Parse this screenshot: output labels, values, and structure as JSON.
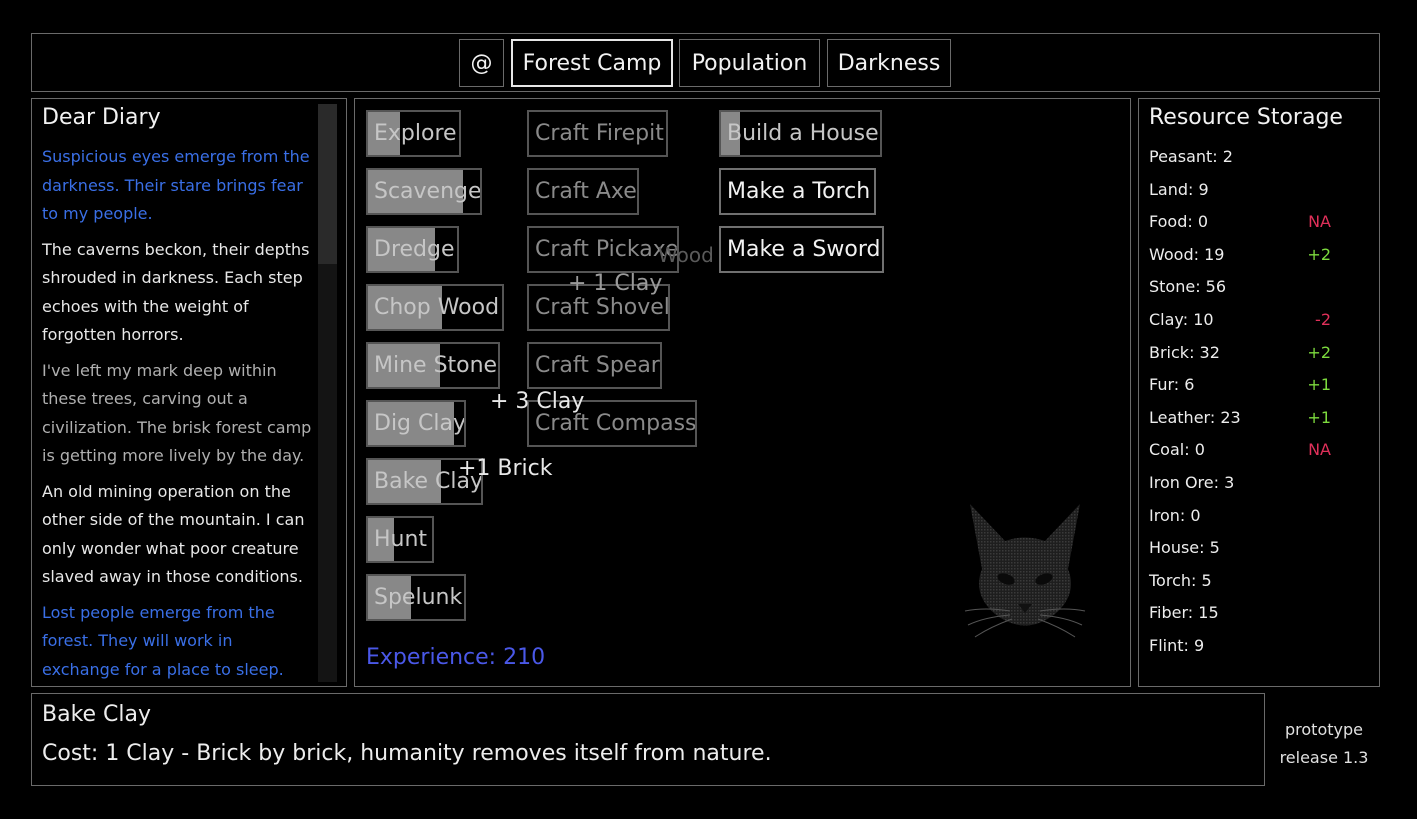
{
  "nav": {
    "home_label": "@",
    "tabs": [
      "Forest Camp",
      "Population",
      "Darkness"
    ]
  },
  "diary": {
    "title": "Dear Diary",
    "entries": [
      "Suspicious eyes emerge from the darkness. Their stare brings fear to my people.",
      "The caverns beckon, their depths shrouded in darkness. Each step echoes with the weight of forgotten horrors.",
      "I've left my mark deep within these trees, carving out a civilization. The brisk forest camp is getting more lively by the day.",
      "An old mining operation on the other side of the mountain. I can only wonder what poor creature slaved away in those conditions.",
      "Lost people emerge from the forest. They will work in exchange for a place to sleep."
    ]
  },
  "actions": {
    "gather": [
      {
        "label": "Explore",
        "progress": 0.35
      },
      {
        "label": "Scavenge",
        "progress": 0.85
      },
      {
        "label": "Dredge",
        "progress": 0.75
      },
      {
        "label": "Chop Wood",
        "progress": 0.55
      },
      {
        "label": "Mine Stone",
        "progress": 0.55
      },
      {
        "label": "Dig Clay",
        "progress": 0.9
      },
      {
        "label": "Bake Clay",
        "progress": 0.65
      },
      {
        "label": "Hunt",
        "progress": 0.4
      },
      {
        "label": "Spelunk",
        "progress": 0.45
      }
    ],
    "craft": [
      "Craft Firepit",
      "Craft Axe",
      "Craft Pickaxe",
      "Craft Shovel",
      "Craft Spear",
      "Craft Compass"
    ],
    "build": [
      {
        "label": "Build a House",
        "progress": 0.12
      },
      {
        "label": "Make a Torch"
      },
      {
        "label": "Make a Sword"
      }
    ]
  },
  "floating_text": [
    "+ 3 Clay",
    "+1 Brick",
    "+ 1 Clay",
    "Wood"
  ],
  "experience": "Experience: 210",
  "resources": {
    "title": "Resource Storage",
    "items": [
      {
        "name": "Peasant: 2",
        "rate": ""
      },
      {
        "name": "Land: 9",
        "rate": ""
      },
      {
        "name": "Food: 0",
        "rate": "NA"
      },
      {
        "name": "Wood: 19",
        "rate": "+2"
      },
      {
        "name": "Stone: 56",
        "rate": ""
      },
      {
        "name": "Clay: 10",
        "rate": "-2"
      },
      {
        "name": "Brick: 32",
        "rate": "+2"
      },
      {
        "name": "Fur: 6",
        "rate": "+1"
      },
      {
        "name": "Leather: 23",
        "rate": "+1"
      },
      {
        "name": "Coal: 0",
        "rate": "NA"
      },
      {
        "name": "Iron Ore: 3",
        "rate": ""
      },
      {
        "name": "Iron: 0",
        "rate": ""
      },
      {
        "name": "House: 5",
        "rate": ""
      },
      {
        "name": "Torch: 5",
        "rate": ""
      },
      {
        "name": "Fiber: 15",
        "rate": ""
      },
      {
        "name": "Flint: 9",
        "rate": ""
      }
    ]
  },
  "info": {
    "title": "Bake Clay",
    "description": "Cost: 1 Clay - Brick by brick, humanity removes itself from nature."
  },
  "version": {
    "line1": "prototype",
    "line2": "release 1.3"
  },
  "colors": {
    "background": "#000000",
    "border": "#6a6a6a",
    "diary_blue": "#3a6fe6",
    "experience": "#4a58e8",
    "rate_positive": "#7ddb3e",
    "rate_negative": "#e0305a",
    "progress_fill": "#888888"
  }
}
